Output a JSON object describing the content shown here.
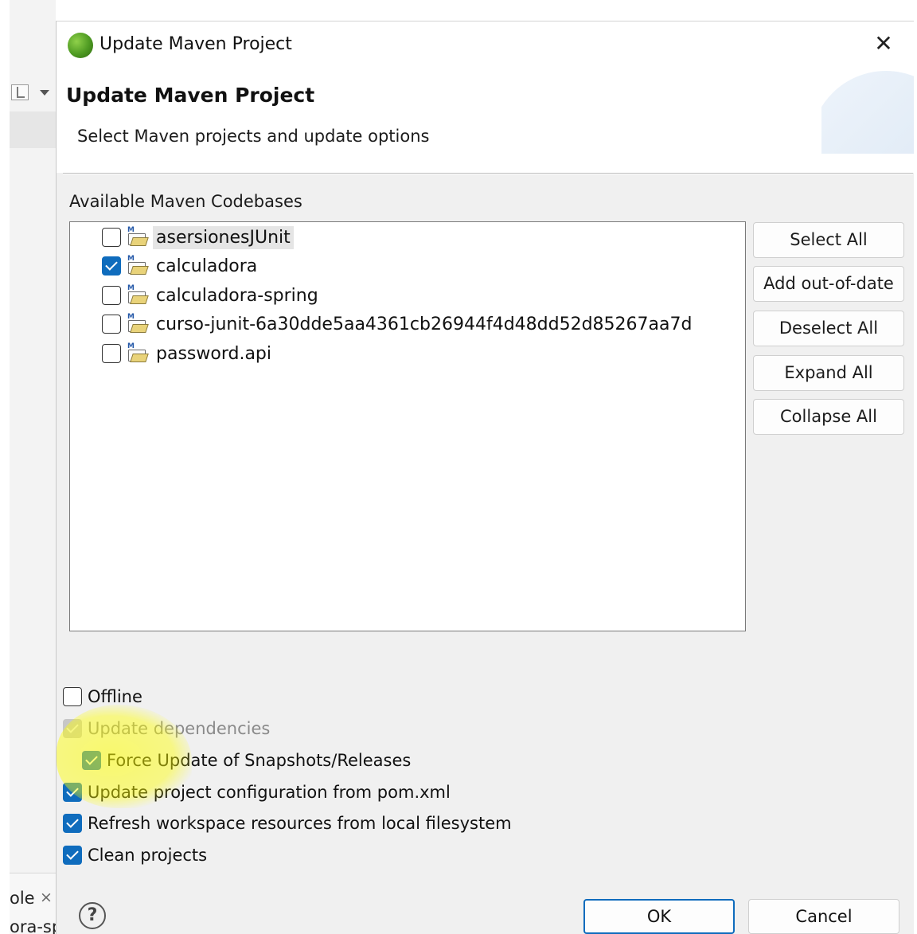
{
  "background": {
    "tab_text": "ole",
    "tab_text2": "ora-sp",
    "tab_close": "×"
  },
  "dialog": {
    "window_title": "Update Maven Project",
    "close_glyph": "✕",
    "header_title": "Update Maven Project",
    "header_subtitle": "Select Maven projects and update options",
    "codebases_label": "Available Maven Codebases",
    "projects": [
      {
        "name": "asersionesJUnit",
        "checked": false
      },
      {
        "name": "calculadora",
        "checked": true
      },
      {
        "name": "calculadora-spring",
        "checked": false
      },
      {
        "name": "curso-junit-6a30dde5aa4361cb26944f4d48dd52d85267aa7d",
        "checked": false
      },
      {
        "name": "password.api",
        "checked": false
      }
    ],
    "buttons": {
      "select_all": "Select All",
      "add_out_of_date": "Add out-of-date",
      "deselect_all": "Deselect All",
      "expand_all": "Expand All",
      "collapse_all": "Collapse All",
      "help": "?",
      "ok": "OK",
      "cancel": "Cancel"
    },
    "options": {
      "offline": {
        "label": "Offline",
        "checked": false
      },
      "update_dependencies": {
        "label": "Update dependencies",
        "checked": true,
        "disabled": true
      },
      "force_update": {
        "label": "Force Update of Snapshots/Releases",
        "checked": true
      },
      "update_config": {
        "label": "Update project configuration from pom.xml",
        "checked": true
      },
      "refresh_workspace": {
        "label": "Refresh workspace resources from local filesystem",
        "checked": true
      },
      "clean_projects": {
        "label": "Clean projects",
        "checked": true
      }
    },
    "accent_color": "#0f6cbd",
    "annotation_color": "#ffff00"
  }
}
